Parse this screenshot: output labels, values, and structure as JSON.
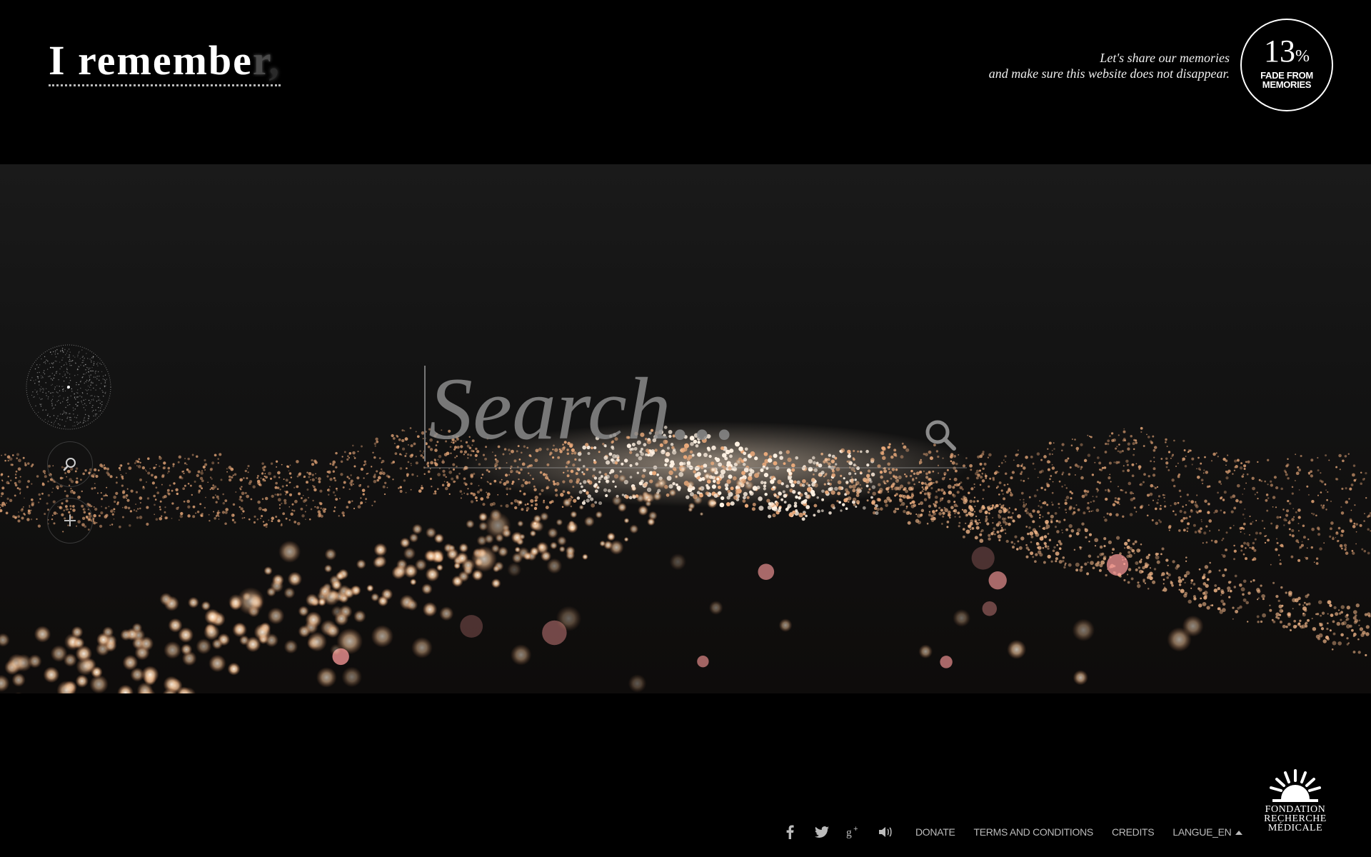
{
  "header": {
    "logo_text": "I remembe",
    "logo_fade_char": "r",
    "logo_fade_punct": ",",
    "tagline_line1": "Let's share our memories",
    "tagline_line2": "and make sure this website does not disappear.",
    "fade_badge": {
      "percent_value": "13",
      "percent_sign": "%",
      "label_line1": "FADE FROM",
      "label_line2": "MEMORIES"
    }
  },
  "search": {
    "placeholder": "Search...",
    "value": ""
  },
  "sidebar": {
    "buttons": [
      {
        "icon": "search-icon"
      },
      {
        "icon": "plus-icon"
      }
    ]
  },
  "footer": {
    "social_icons": [
      "facebook-icon",
      "twitter-icon",
      "google-plus-icon",
      "speaker-icon"
    ],
    "links": [
      "DONATE",
      "TERMS AND CONDITIONS",
      "CREDITS"
    ],
    "language": "LANGUE_EN",
    "foundation": {
      "line1": "FONDATION",
      "line2": "RECHERCHE",
      "line3": "MÉDICALE"
    }
  },
  "colors": {
    "background": "#000000",
    "scene": "#141414",
    "particle": "#f0c49a"
  }
}
